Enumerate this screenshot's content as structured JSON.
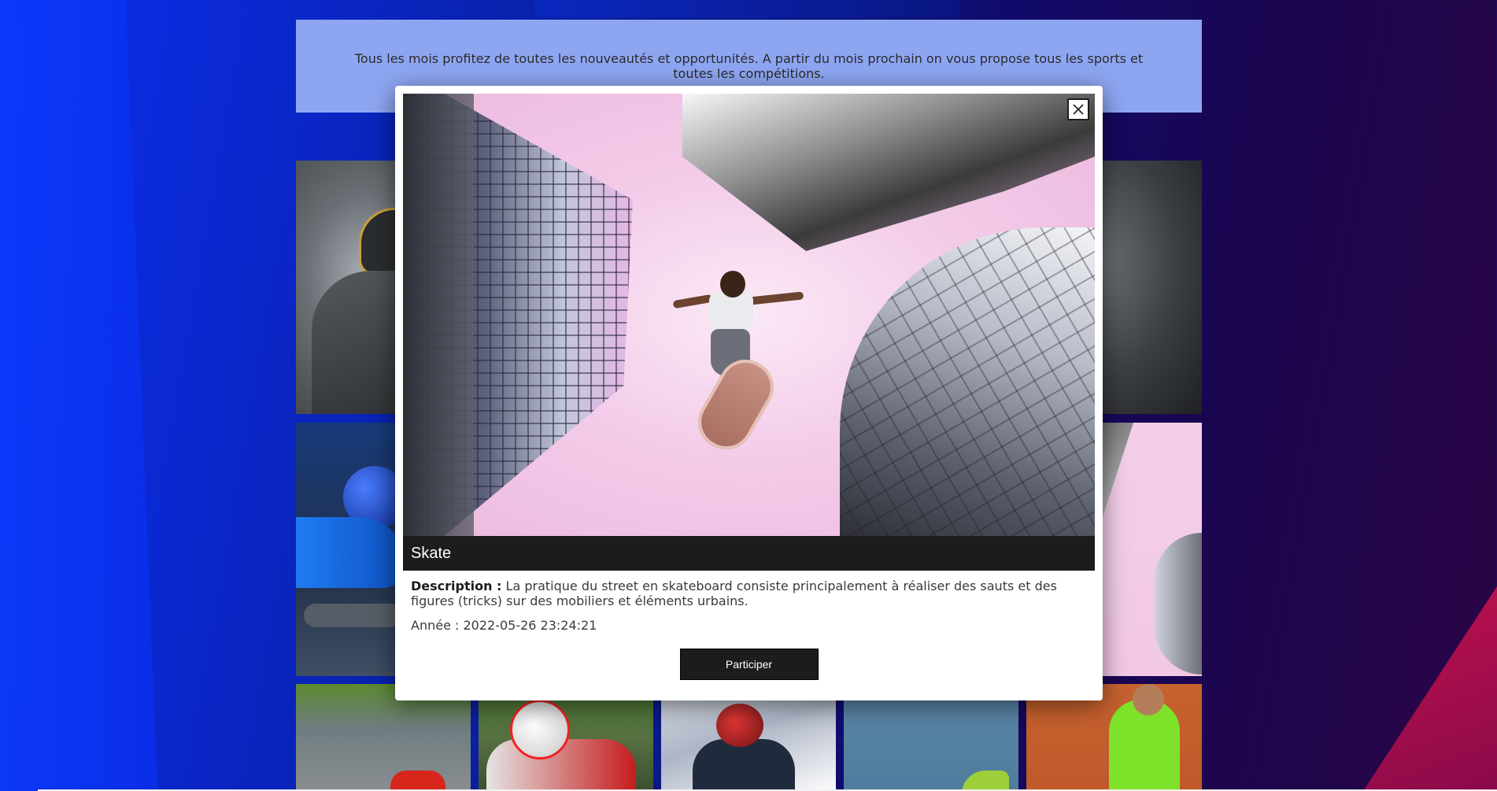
{
  "banner": {
    "text": "Tous les mois profitez de toutes les nouveautés et opportunités. A partir du mois prochain on vous propose tous les sports et toutes les compétitions."
  },
  "modal": {
    "image_subject": "skateboarder-jumping-between-buildings",
    "title": "Skate",
    "description_label": "Description :",
    "description_text": "La pratique du street en skateboard consiste principalement à réaliser des sauts et des figures (tricks) sur des mobiliers et éléments urbains.",
    "year_text": "Année : 2022-05-26 23:24:21",
    "participate_label": "Participer"
  },
  "gallery": {
    "tiles": [
      {
        "subject": "american-football-player"
      },
      {
        "subject": "storm-clouds"
      },
      {
        "subject": "bobsled-athlete"
      },
      {
        "subject": "skateboarder"
      },
      {
        "subject": "motorbike-track"
      },
      {
        "subject": "motorbike-racer"
      },
      {
        "subject": "skier-red-helmet"
      },
      {
        "subject": "athlete-on-blue-court"
      },
      {
        "subject": "tennis-player-clay"
      }
    ]
  },
  "colors": {
    "banner_bg": "#8ea6f2",
    "modal_bar": "#1c1c1c",
    "accent_right": "#c0114d"
  }
}
